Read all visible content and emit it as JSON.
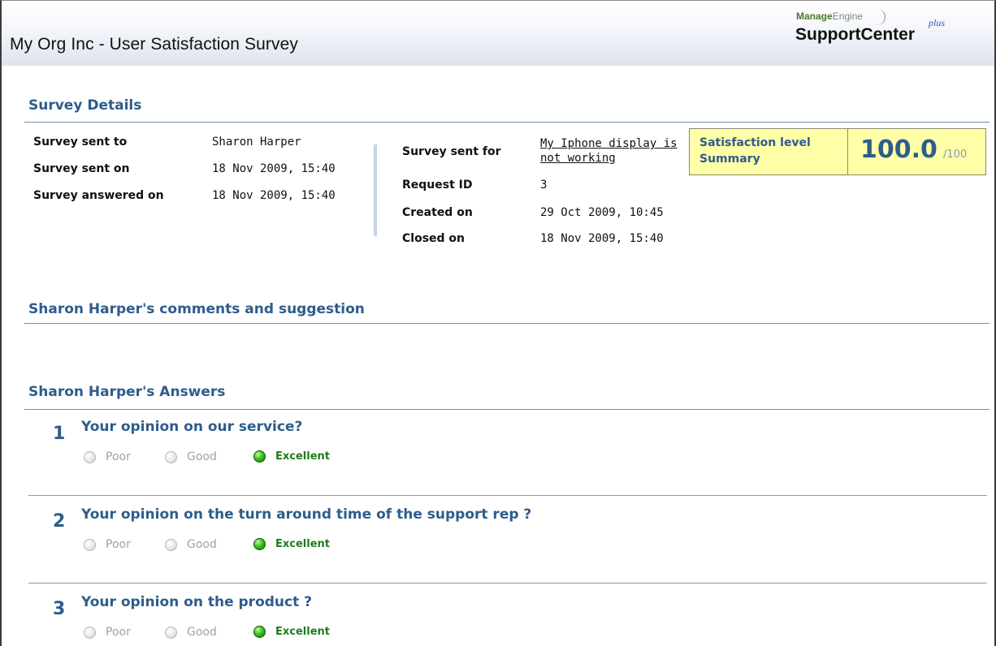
{
  "header": {
    "title": "My Org Inc - User Satisfaction Survey"
  },
  "logo": {
    "manage": "Manage",
    "engine": "Engine",
    "product": "SupportCenter",
    "plus": "plus"
  },
  "details": {
    "section_title": "Survey Details",
    "sent_to_label": "Survey sent to",
    "sent_to_value": "Sharon Harper",
    "sent_on_label": "Survey sent on",
    "sent_on_value": "18 Nov 2009, 15:40",
    "answered_on_label": "Survey answered on",
    "answered_on_value": "18 Nov 2009, 15:40",
    "sent_for_label": "Survey sent for",
    "sent_for_link": "My Iphone display is not working",
    "request_id_label": "Request ID",
    "request_id_value": "3",
    "created_on_label": "Created on",
    "created_on_value": "29 Oct 2009, 10:45",
    "closed_on_label": "Closed on",
    "closed_on_value": "18 Nov 2009, 15:40"
  },
  "satisfaction": {
    "label_line1": "Satisfaction level",
    "label_line2": "Summary",
    "score": "100.0",
    "max": "/100"
  },
  "comments": {
    "section_title": "Sharon Harper's comments and suggestion"
  },
  "answers": {
    "section_title": "Sharon Harper's Answers",
    "questions": [
      {
        "number": "1",
        "text": "Your opinion on our service?",
        "options": [
          "Poor",
          "Good",
          "Excellent"
        ],
        "selected": "Excellent"
      },
      {
        "number": "2",
        "text": "Your opinion on the turn around time of the support rep ?",
        "options": [
          "Poor",
          "Good",
          "Excellent"
        ],
        "selected": "Excellent"
      },
      {
        "number": "3",
        "text": "Your opinion on the product ?",
        "options": [
          "Poor",
          "Good",
          "Excellent"
        ],
        "selected": "Excellent"
      }
    ]
  },
  "colors": {
    "accent": "#2e5c8c",
    "selected": "#1e7b1e",
    "summary_bg": "#ffffa8"
  }
}
